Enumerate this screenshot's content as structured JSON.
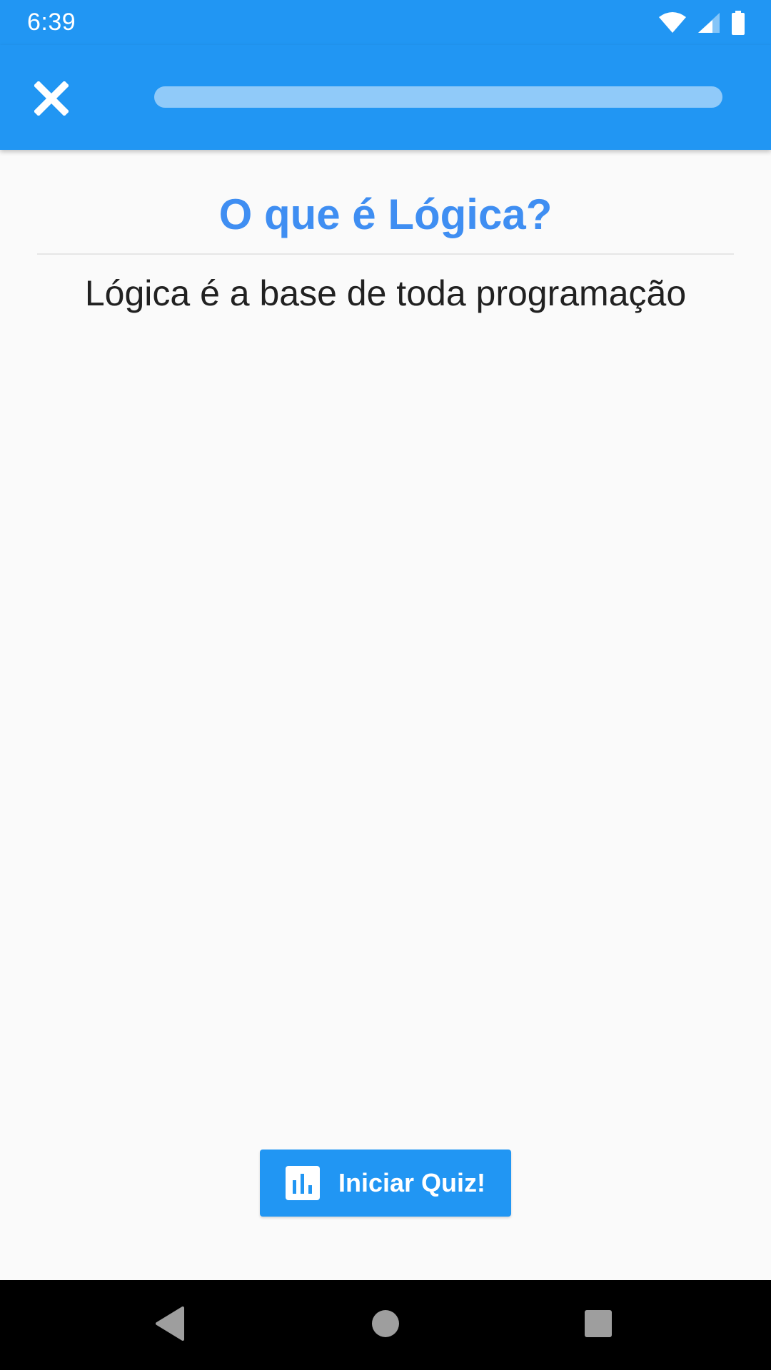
{
  "status_bar": {
    "time": "6:39",
    "icons": [
      "wifi-icon",
      "cellular-signal-icon",
      "battery-icon"
    ]
  },
  "app_bar": {
    "close_icon": "close-icon",
    "progress": 0.0
  },
  "content": {
    "title": "O que é Lógica?",
    "description": "Lógica é a base de toda programação"
  },
  "quiz_button": {
    "icon": "bar-chart-icon",
    "label": "Iniciar Quiz!"
  },
  "navigation": {
    "buttons": [
      "back-icon",
      "home-icon",
      "recents-icon"
    ]
  },
  "colors": {
    "primary": "#2196f3",
    "title": "#3f8ef2",
    "progress_track": "#90caf9",
    "background": "#fafafa"
  }
}
